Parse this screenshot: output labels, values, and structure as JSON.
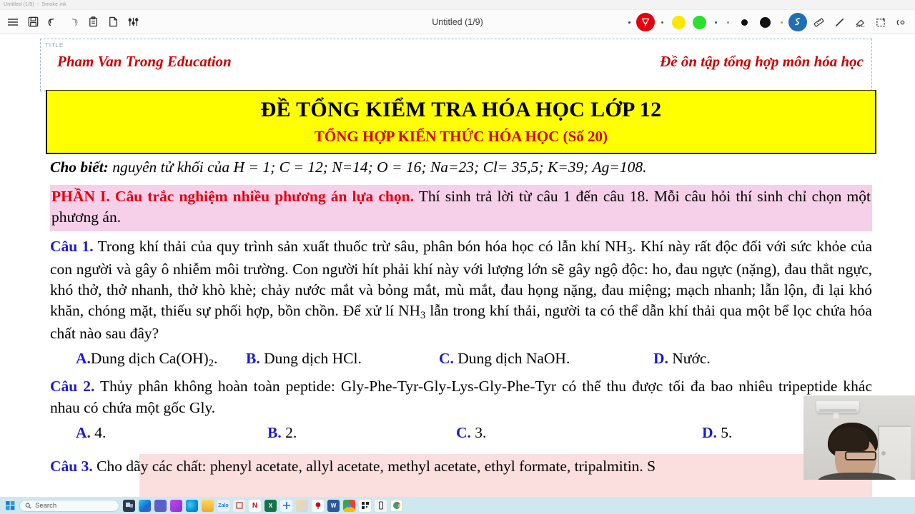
{
  "window": {
    "title": "Untitled (1/9)",
    "app": "Smoke ink"
  },
  "toolbar": {
    "doc_title": "Untitled (1/9)",
    "left_buttons": [
      {
        "name": "menu",
        "label": "Menu"
      },
      {
        "name": "save",
        "label": "Save"
      },
      {
        "name": "undo",
        "label": "Undo"
      },
      {
        "name": "redo",
        "label": "Redo"
      },
      {
        "name": "paste",
        "label": "Paste"
      },
      {
        "name": "new-page",
        "label": "New page"
      },
      {
        "name": "settings",
        "label": "Settings"
      }
    ],
    "colors": {
      "selected_pen": "#e3000f",
      "yellow": "#ffe600",
      "green": "#2ee02e",
      "black": "#000000",
      "blue": "#1f6fb2"
    },
    "right_buttons": [
      {
        "name": "pen-red",
        "label": "Pen"
      },
      {
        "name": "highlighter-yellow",
        "label": "Yellow"
      },
      {
        "name": "highlighter-green",
        "label": "Green"
      },
      {
        "name": "pen-thin-black",
        "label": "Thin black"
      },
      {
        "name": "pen-thick-black",
        "label": "Thick black"
      },
      {
        "name": "ink-tool",
        "label": "Ink"
      },
      {
        "name": "ruler",
        "label": "Ruler"
      },
      {
        "name": "line",
        "label": "Line"
      },
      {
        "name": "eraser",
        "label": "Eraser"
      },
      {
        "name": "select",
        "label": "Select"
      },
      {
        "name": "laser",
        "label": "Laser pointer"
      }
    ]
  },
  "page": {
    "title_placeholder": "TITLE",
    "header_left": "Pham Van Trong Education",
    "header_right": "Đề ôn tập tổng hợp môn hóa học",
    "banner_line1": "ĐỀ TỔNG KIỂM TRA HÓA HỌC LỚP 12",
    "banner_line2": "TỔNG HỢP KIẾN THỨC HÓA HỌC (Số 20)",
    "banner_bg": "#ffff00",
    "cho_biet_label": "Cho biết:",
    "cho_biet_text": "nguyên tử khối của H = 1; C = 12; N=14; O = 16; Na=23; Cl= 35,5; K=39; Ag=108.",
    "part1_heading": "PHẦN I. Câu trắc nghiệm nhiều phương án lựa chọn.",
    "part1_text": "Thí sinh trả lời từ câu 1 đến câu 18. Mỗi câu hỏi thí sinh chỉ chọn một phương án.",
    "questions": [
      {
        "label": "Câu 1.",
        "text_pre": "Trong khí thải của quy trình sản xuất thuốc trừ sâu, phân bón hóa học có lẫn khí NH",
        "sub1": "3",
        "text_mid": ". Khí này rất độc đối với sức khỏe của con người và gây ô nhiễm môi trường. Con người hít phải khí này với lượng lớn sẽ gây ngộ độc: ho, đau ngực (nặng), đau thắt ngực, khó thở, thở nhanh, thở khò khè; chảy nước mắt và bỏng mắt, mù mắt, đau họng nặng, đau miệng; mạch nhanh; lẫn lộn, đi lại khó khăn, chóng mặt, thiếu sự phối hợp, bồn chồn. Để xử lí NH",
        "sub2": "3",
        "text_post": " lẫn trong khí thải, người ta có thể dẫn khí thải qua một bể lọc chứa hóa chất nào sau đây?",
        "options": [
          {
            "key": "A.",
            "text": "Dung dịch Ca(OH)",
            "sub": "2",
            "tail": "."
          },
          {
            "key": "B.",
            "text": " Dung dịch HCl.",
            "sub": "",
            "tail": ""
          },
          {
            "key": "C.",
            "text": " Dung dịch NaOH.",
            "sub": "",
            "tail": ""
          },
          {
            "key": "D.",
            "text": " Nước.",
            "sub": "",
            "tail": ""
          }
        ]
      },
      {
        "label": "Câu 2.",
        "text": "Thủy phân không hoàn toàn peptide: Gly-Phe-Tyr-Gly-Lys-Gly-Phe-Tyr có thể thu được tối đa bao nhiêu tripeptide khác nhau có chứa một gốc Gly.",
        "options": [
          {
            "key": "A.",
            "text": " 4."
          },
          {
            "key": "B.",
            "text": " 2."
          },
          {
            "key": "C.",
            "text": " 3."
          },
          {
            "key": "D.",
            "text": " 5."
          }
        ]
      },
      {
        "label": "Câu 3.",
        "text": "Cho dãy các chất: phenyl acetate, allyl acetate, methyl acetate, ethyl formate, tripalmitin. S"
      }
    ]
  },
  "taskbar": {
    "search_placeholder": "Search",
    "items": [
      {
        "name": "start",
        "label": "Start"
      },
      {
        "name": "search",
        "label": "Search"
      },
      {
        "name": "taskview",
        "label": "Task View"
      },
      {
        "name": "edge-copilot",
        "label": "Copilot"
      },
      {
        "name": "teams",
        "label": "Teams"
      },
      {
        "name": "explorer-purple",
        "label": "Store"
      },
      {
        "name": "edge",
        "label": "Edge"
      },
      {
        "name": "file-explorer",
        "label": "File Explorer"
      },
      {
        "name": "zalo",
        "label": "Zalo"
      },
      {
        "name": "unikey",
        "label": "Unikey"
      },
      {
        "name": "app-red",
        "label": "App"
      },
      {
        "name": "excel",
        "label": "Excel"
      },
      {
        "name": "app-blue",
        "label": "App"
      },
      {
        "name": "paint",
        "label": "Paint"
      },
      {
        "name": "app-balloon",
        "label": "App"
      },
      {
        "name": "word",
        "label": "Word"
      },
      {
        "name": "chrome",
        "label": "Chrome"
      },
      {
        "name": "qr-app",
        "label": "QR"
      },
      {
        "name": "phone-link",
        "label": "Phone"
      },
      {
        "name": "chrome-active",
        "label": "Chrome"
      }
    ]
  }
}
